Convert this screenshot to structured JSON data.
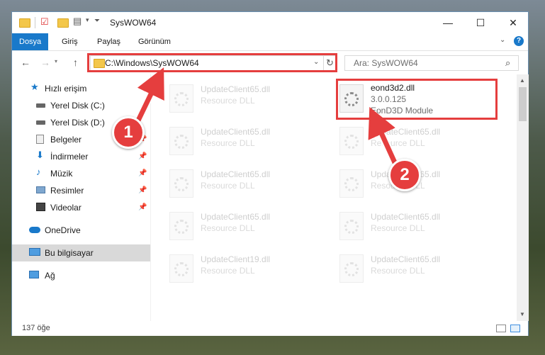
{
  "window": {
    "title": "SysWOW64",
    "controls": {
      "minimize": "—",
      "maximize": "☐",
      "close": "✕"
    }
  },
  "ribbon": {
    "tabs": [
      "Dosya",
      "Giriş",
      "Paylaş",
      "Görünüm"
    ],
    "help": "?"
  },
  "address": {
    "path": "C:\\Windows\\SysWOW64",
    "search_placeholder": "Ara: SysWOW64"
  },
  "sidebar": {
    "items": [
      {
        "label": "Hızlı erişim",
        "icon": "star-icon"
      },
      {
        "label": "Yerel Disk (C:)",
        "icon": "drive-icon"
      },
      {
        "label": "Yerel Disk (D:)",
        "icon": "drive-icon"
      },
      {
        "label": "Belgeler",
        "icon": "documents-icon"
      },
      {
        "label": "İndirmeler",
        "icon": "download-icon"
      },
      {
        "label": "Müzik",
        "icon": "music-icon"
      },
      {
        "label": "Resimler",
        "icon": "pictures-icon"
      },
      {
        "label": "Videolar",
        "icon": "videos-icon"
      },
      {
        "label": "OneDrive",
        "icon": "cloud-icon"
      },
      {
        "label": "Bu bilgisayar",
        "icon": "computer-icon"
      },
      {
        "label": "Ağ",
        "icon": "network-icon"
      }
    ]
  },
  "files": {
    "highlighted": {
      "name": "eond3d2.dll",
      "version": "3.0.0.125",
      "desc": "EonD3D Module"
    },
    "left": [
      {
        "name": "UpdateClient65.dll",
        "desc": "Resource DLL"
      },
      {
        "name": "UpdateClient65.dll",
        "desc": "Resource DLL"
      },
      {
        "name": "UpdateClient65.dll",
        "desc": "Resource DLL"
      },
      {
        "name": "UpdateClient65.dll",
        "desc": "Resource DLL"
      },
      {
        "name": "UpdateClient19.dll",
        "desc": "Resource DLL"
      }
    ],
    "right": [
      {
        "name": "UpdateClient65.dll",
        "desc": "Resource DLL"
      },
      {
        "name": "UpdateClient65.dll",
        "desc": "Resource DLL"
      },
      {
        "name": "UpdateClient65.dll",
        "desc": "Resource DLL"
      },
      {
        "name": "UpdateClient65.dll",
        "desc": "Resource DLL"
      }
    ]
  },
  "status": {
    "count": "137 öğe"
  },
  "callouts": {
    "one": "1",
    "two": "2"
  },
  "colors": {
    "accent": "#1979ca",
    "highlight": "#e53e3e"
  }
}
